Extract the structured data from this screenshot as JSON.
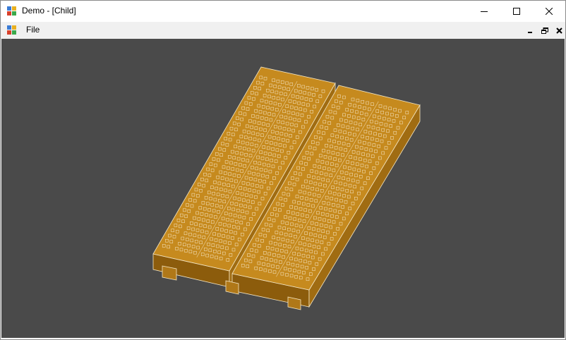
{
  "window": {
    "title": "Demo - [Child]"
  },
  "titlebar": {
    "icon": "app-window-icon",
    "buttons": [
      {
        "name": "minimize",
        "icon": "minimize-icon"
      },
      {
        "name": "maximize",
        "icon": "maximize-icon"
      },
      {
        "name": "close",
        "icon": "close-icon"
      }
    ]
  },
  "menubar": {
    "icon": "child-window-icon",
    "items": [
      {
        "label": "File"
      }
    ],
    "mdi_buttons": [
      {
        "name": "minimize",
        "icon": "minimize-icon"
      },
      {
        "name": "restore",
        "icon": "restore-icon"
      },
      {
        "name": "close",
        "icon": "close-icon"
      }
    ]
  },
  "viewport": {
    "background": "#4a4a4a",
    "model": {
      "name": "breadboard",
      "top_color": "#c68a1e",
      "side_color": "#a06c12",
      "front_color": "#8c5c0c",
      "edge_color": "#f4e6c4"
    }
  }
}
